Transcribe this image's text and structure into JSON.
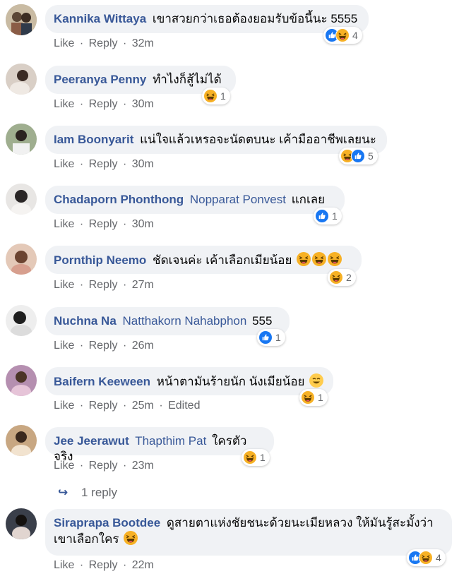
{
  "comments": [
    {
      "author": "Kannika Wittaya",
      "text": "เขาสวยกว่าเธอต้องยอมรับข้อนี้นะ 5555",
      "reaction_count": "4",
      "time": "32m"
    },
    {
      "author": "Peeranya Penny",
      "text": "ทำไงก็สู้ไม่ได้",
      "reaction_count": "1",
      "time": "30m"
    },
    {
      "author": "Iam Boonyarit",
      "text": "แน่ใจแล้วเหรอจะนัดตบนะ เค้ามืออาชีพเลยนะ",
      "reaction_count": "5",
      "time": "30m"
    },
    {
      "author": "Chadaporn Phonthong",
      "mention": "Nopparat Ponvest",
      "text": "แกเลย",
      "reaction_count": "1",
      "time": "30m"
    },
    {
      "author": "Pornthip Neemo",
      "text": "ชัดเจนค่ะ เค้าเลือกเมียน้อย",
      "reaction_count": "2",
      "time": "27m"
    },
    {
      "author": "Nuchna Na",
      "mention": "Natthakorn Nahabphon",
      "text": "555",
      "reaction_count": "1",
      "time": "26m"
    },
    {
      "author": "Baifern Keeween",
      "text": "หน้าตามันร้ายนัก นังเมียน้อย",
      "reaction_count": "1",
      "time": "25m",
      "edited": "Edited"
    },
    {
      "author": "Jee Jeerawut",
      "mention": "Thapthim Pat",
      "text": "ใครตัวจริง",
      "reaction_count": "1",
      "time": "23m"
    },
    {
      "author": "Siraprapa Bootdee",
      "text": "ดูสายตาแห่งชัยชนะด้วยนะเมียหลวง ให้มันรู้สะมั้งว่า",
      "text2": "เขาเลือกใคร",
      "reaction_count": "4",
      "time": "22m"
    }
  ],
  "actions": {
    "like": "Like",
    "reply": "Reply",
    "sep": "·"
  },
  "replies_link": {
    "arrow": "↪",
    "label": "1 reply"
  },
  "colors": {
    "name": "#385898",
    "bubble": "#f0f2f5",
    "meta": "#65676b",
    "like": "#1877f2",
    "haha": "#f7b125"
  },
  "icons": {
    "like": "like-reaction-icon",
    "haha": "haha-reaction-icon"
  }
}
